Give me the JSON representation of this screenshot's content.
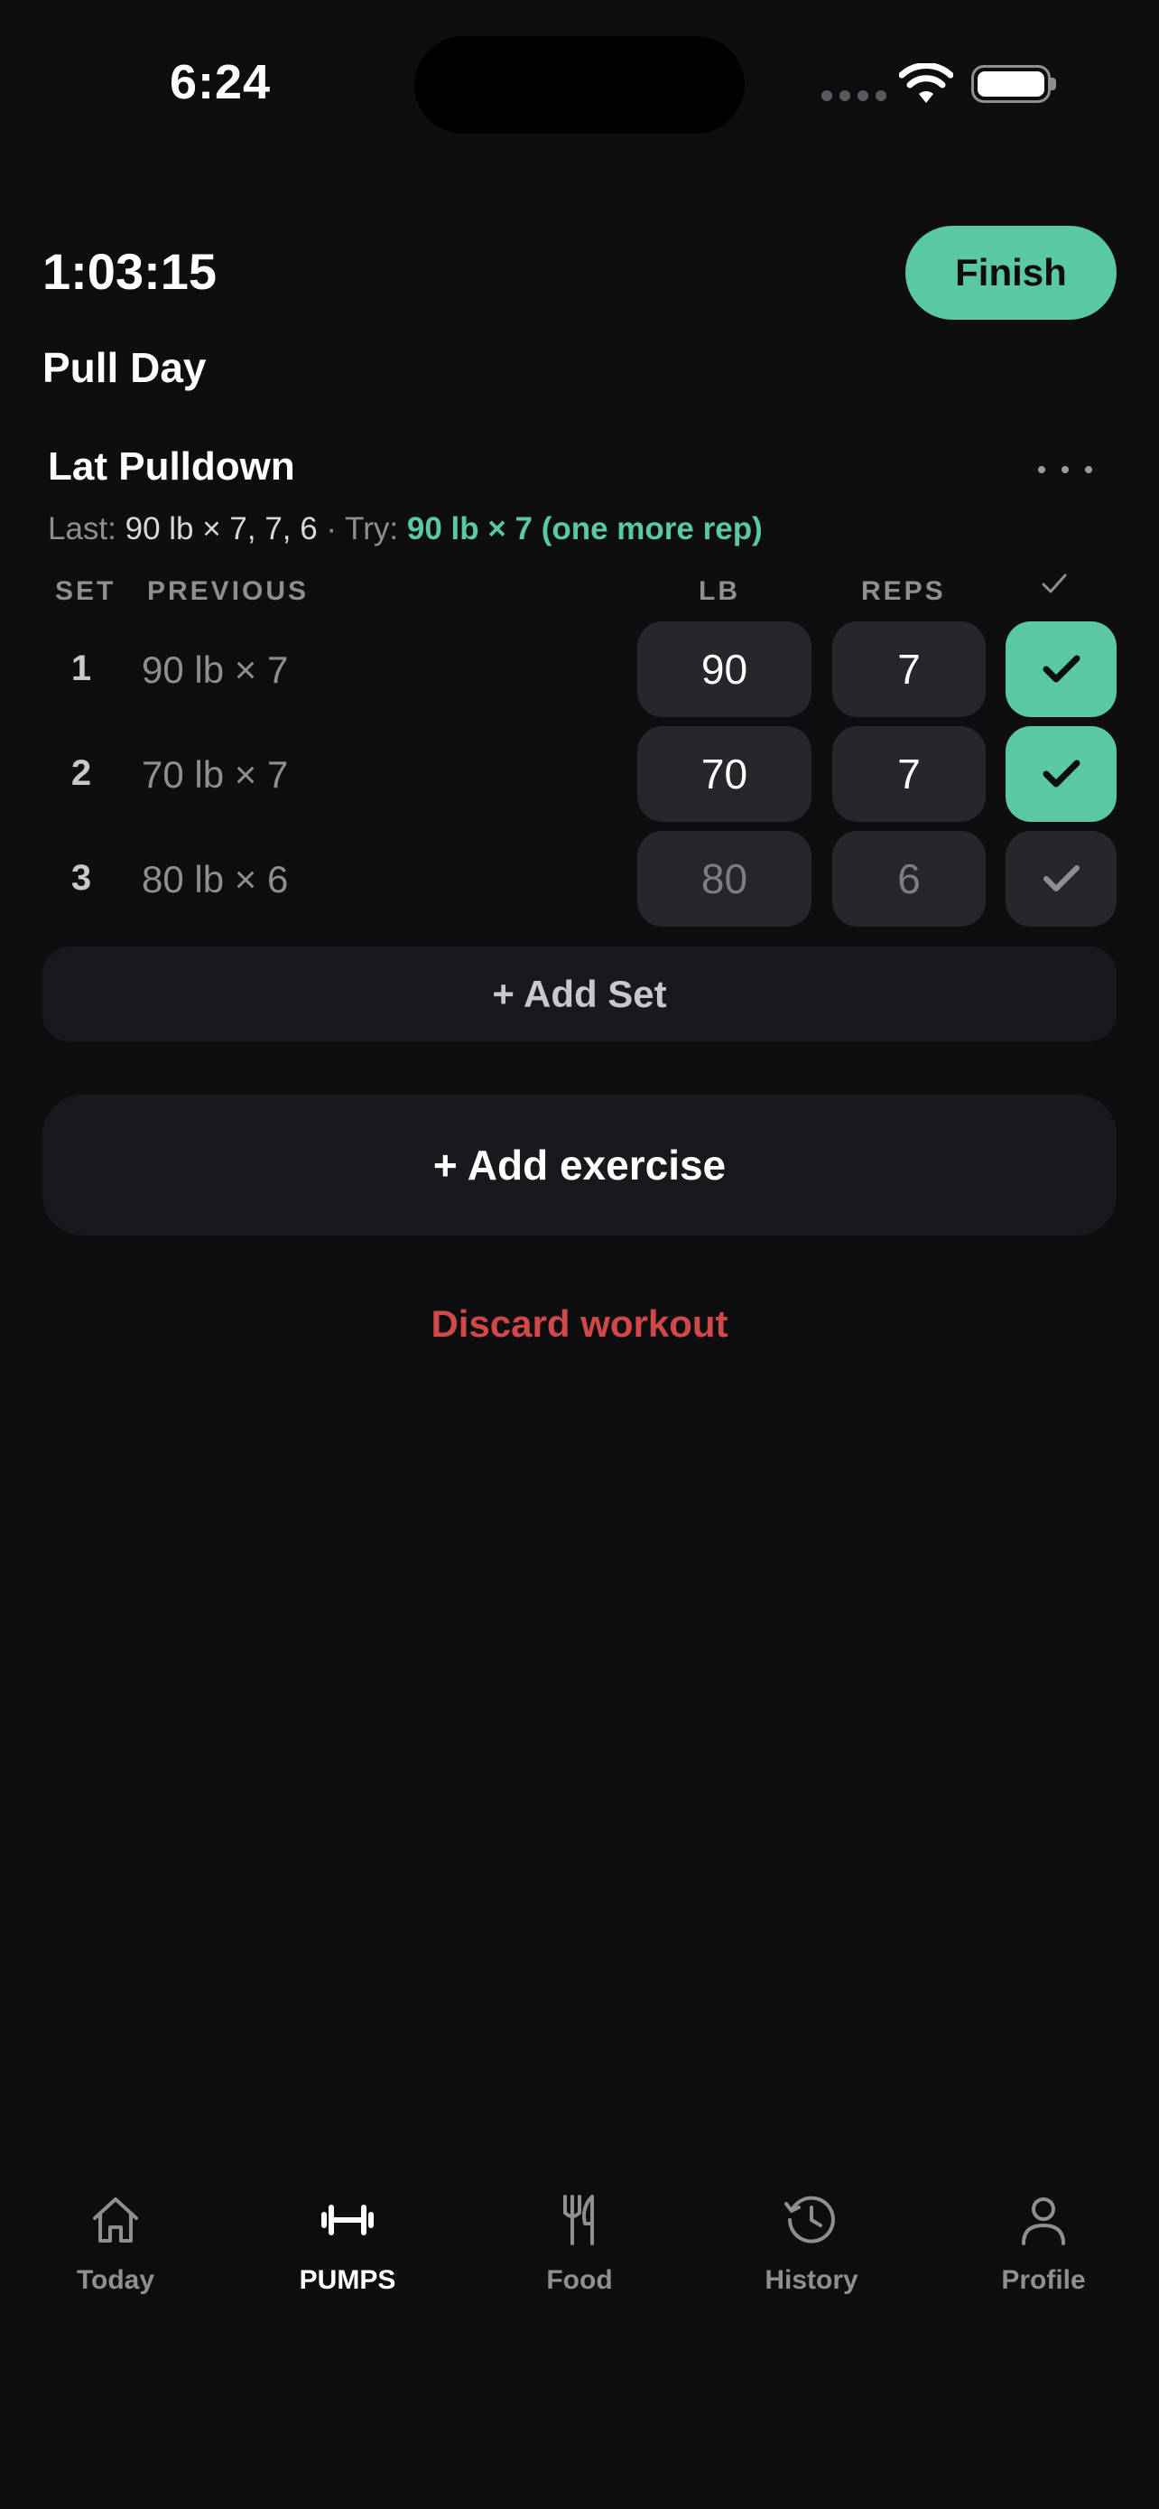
{
  "status_bar": {
    "time": "6:24"
  },
  "header": {
    "elapsed": "1:03:15",
    "finish_label": "Finish",
    "workout_title": "Pull Day"
  },
  "exercise": {
    "name": "Lat Pulldown",
    "last_prefix": "Last:",
    "last_value": "90 lb × 7, 7, 6",
    "try_prefix": " · Try: ",
    "try_value": "90 lb × 7 (one more rep)",
    "columns": {
      "set": "SET",
      "previous": "PREVIOUS",
      "lb": "LB",
      "reps": "REPS"
    },
    "sets": [
      {
        "num": "1",
        "previous": "90 lb × 7",
        "lb": "90",
        "reps": "7",
        "done": true
      },
      {
        "num": "2",
        "previous": "70 lb × 7",
        "lb": "70",
        "reps": "7",
        "done": true
      },
      {
        "num": "3",
        "previous": "80 lb × 6",
        "lb": "80",
        "reps": "6",
        "done": false
      }
    ],
    "add_set_label": "+ Add Set"
  },
  "actions": {
    "add_exercise_label": "+ Add exercise",
    "discard_label": "Discard workout"
  },
  "tabs": [
    {
      "label": "Today",
      "icon": "home-icon",
      "active": false
    },
    {
      "label": "PUMPS",
      "icon": "dumbbell-icon",
      "active": true
    },
    {
      "label": "Food",
      "icon": "fork-knife-icon",
      "active": false
    },
    {
      "label": "History",
      "icon": "history-icon",
      "active": false
    },
    {
      "label": "Profile",
      "icon": "person-icon",
      "active": false
    }
  ],
  "colors": {
    "accent": "#5ac8a0",
    "danger": "#d04848",
    "background": "#0e0e11",
    "cell": "#26262b"
  }
}
